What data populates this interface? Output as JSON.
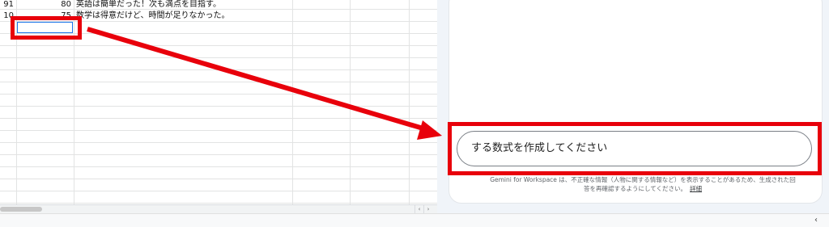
{
  "sheet": {
    "rows": [
      {
        "a": "91",
        "b": "80",
        "c": "英語は簡単だった！次も満点を目指す。"
      },
      {
        "a": "10",
        "b": "75",
        "c": "数学は得意だけど、時間が足りなかった。"
      }
    ]
  },
  "gemini": {
    "input_text": "する数式を作成してください",
    "disclaimer_text": "Gemini for Workspace は、不正確な情報（人物に関する情報など）を表示することがあるため、生成された回答を再確認するようにしてください。",
    "disclaimer_link": "詳細"
  },
  "annotation": {
    "color": "#e8000b"
  },
  "scroll": {
    "left_arrow": "‹",
    "right_arrow": "›"
  },
  "footer": {
    "collapse_chevron": "‹"
  }
}
